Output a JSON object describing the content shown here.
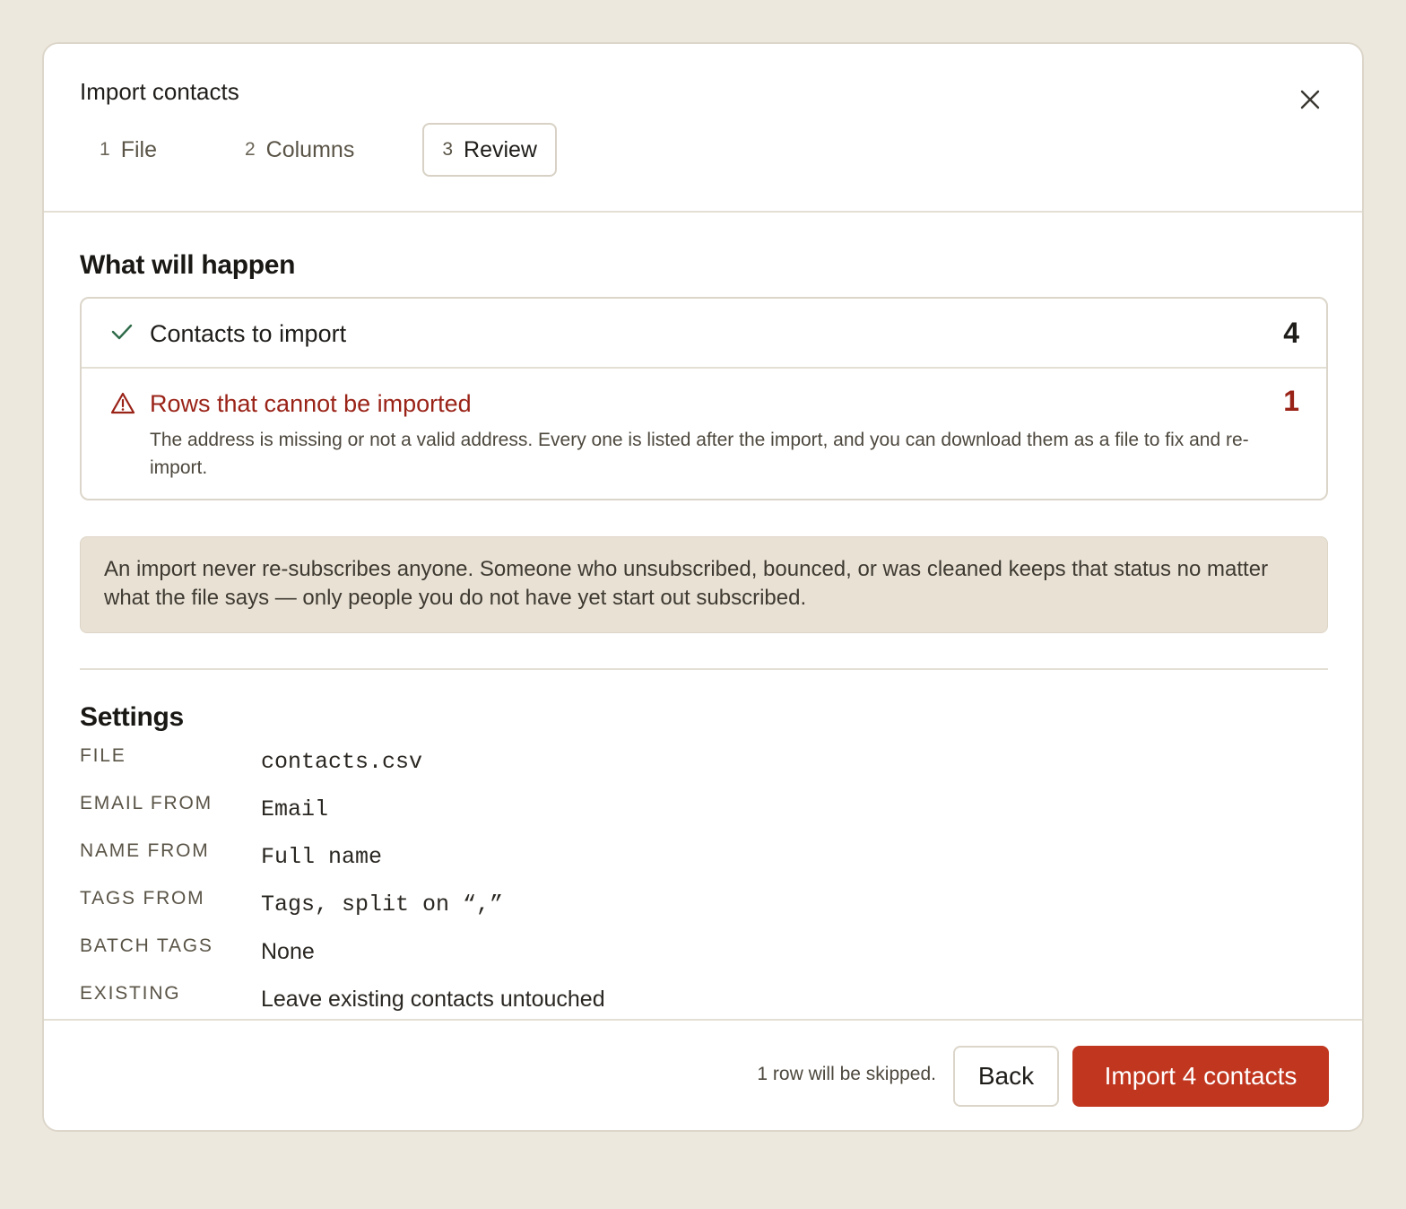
{
  "dialog": {
    "title": "Import contacts",
    "close_icon": "close-icon"
  },
  "steps": [
    {
      "num": "1",
      "label": "File",
      "active": false
    },
    {
      "num": "2",
      "label": "Columns",
      "active": false
    },
    {
      "num": "3",
      "label": "Review",
      "active": true
    }
  ],
  "summary": {
    "heading": "What will happen",
    "ok": {
      "icon": "check-icon",
      "label": "Contacts to import",
      "count": "4"
    },
    "bad": {
      "icon": "warning-icon",
      "label": "Rows that cannot be imported",
      "count": "1",
      "description": "The address is missing or not a valid address. Every one is listed after the import, and you can download them as a file to fix and re-import."
    }
  },
  "note": "An import never re-subscribes anyone. Someone who unsubscribed, bounced, or was cleaned keeps that status no matter what the file says — only people you do not have yet start out subscribed.",
  "settings": {
    "heading": "Settings",
    "rows": [
      {
        "key": "File",
        "value": "contacts.csv"
      },
      {
        "key": "Email from",
        "value": "Email"
      },
      {
        "key": "Name from",
        "value": "Full name"
      },
      {
        "key": "Tags from",
        "value": "Tags, split on “,”"
      },
      {
        "key": "Batch tags",
        "value": "None"
      },
      {
        "key": "Existing",
        "value": "Leave existing contacts untouched"
      }
    ]
  },
  "footer": {
    "skip_note": "1 row will be skipped.",
    "back_label": "Back",
    "import_label": "Import 4 contacts"
  },
  "colors": {
    "accent": "#c0361f",
    "error": "#9a2318",
    "success": "#2f6b4a",
    "background": "#ede8dd",
    "note_bg": "#e9e1d4"
  }
}
